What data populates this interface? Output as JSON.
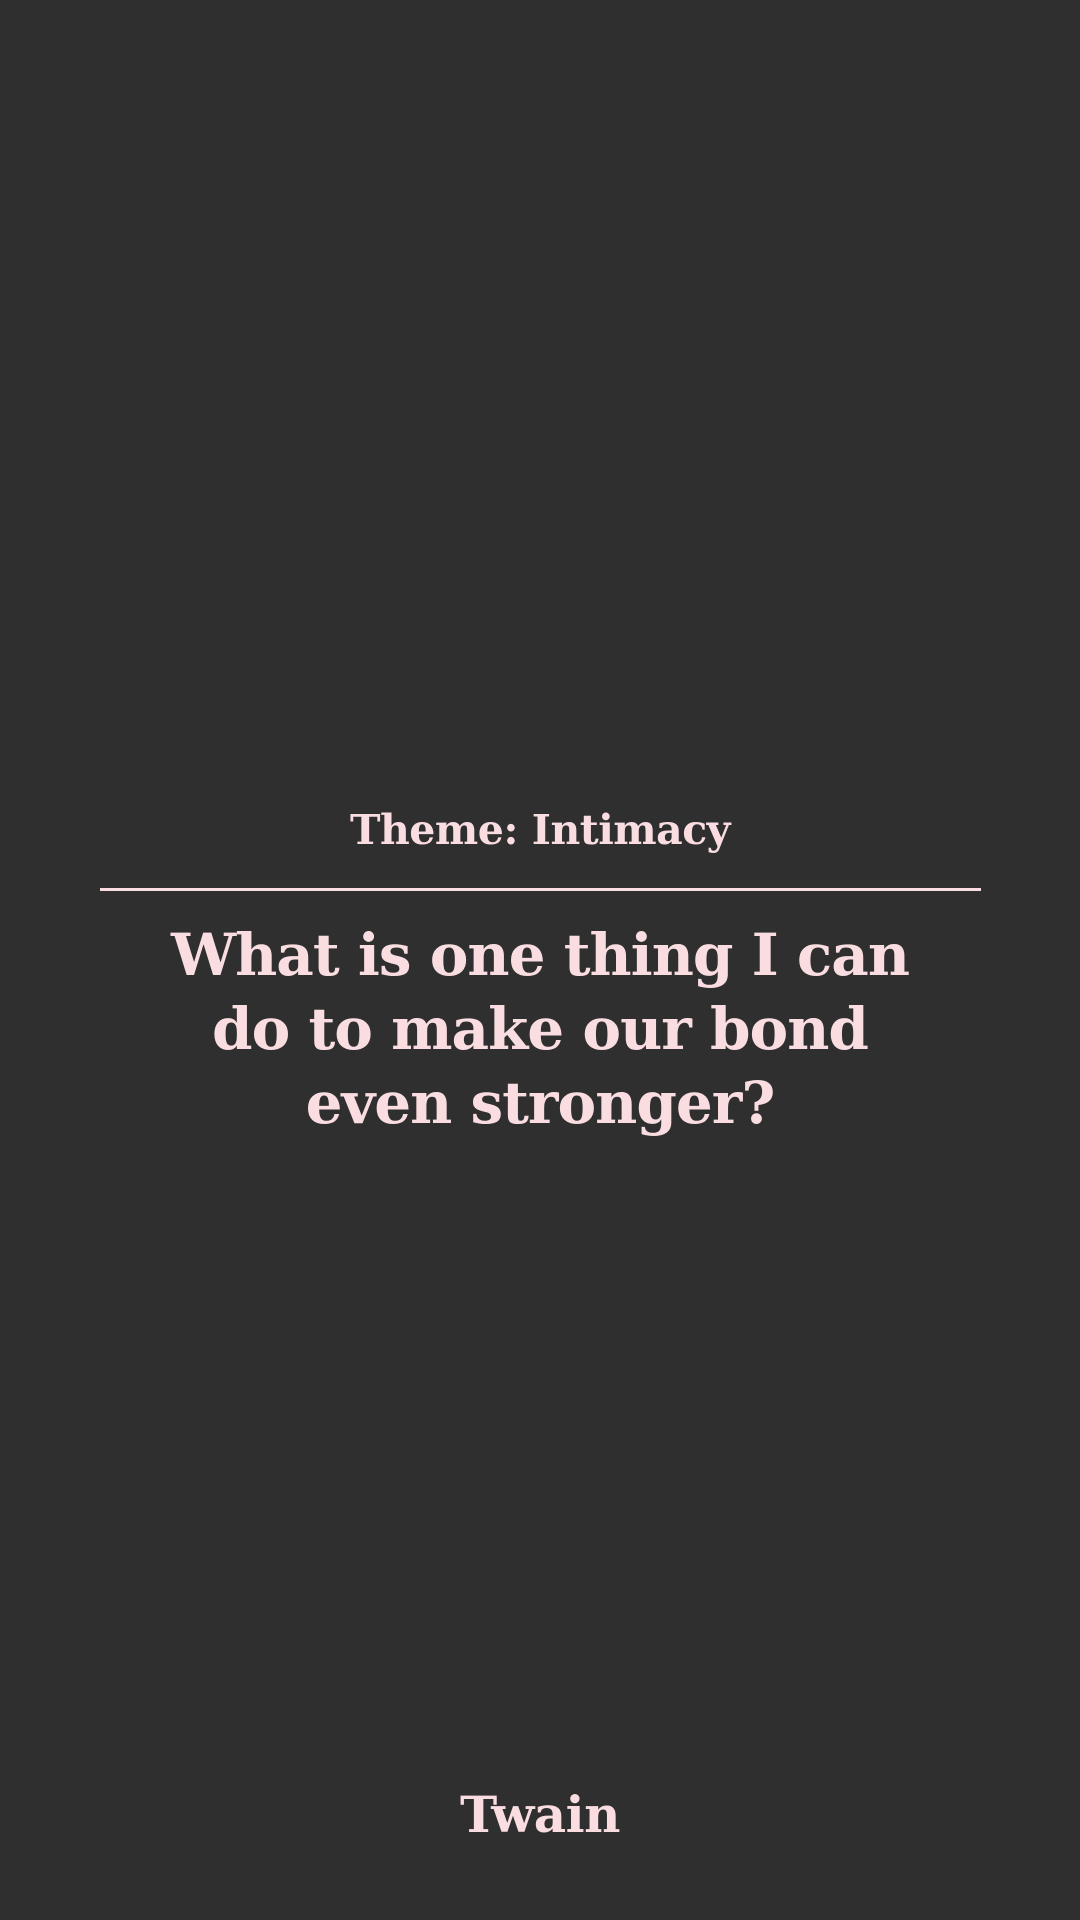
{
  "card": {
    "theme_label": "Theme: Intimacy",
    "question": "What is one thing I can do to make our bond even stronger?"
  },
  "footer": {
    "brand": "Twain"
  },
  "colors": {
    "background": "#2f2f2f",
    "text": "#fadde1",
    "divider": "#fadde1"
  }
}
